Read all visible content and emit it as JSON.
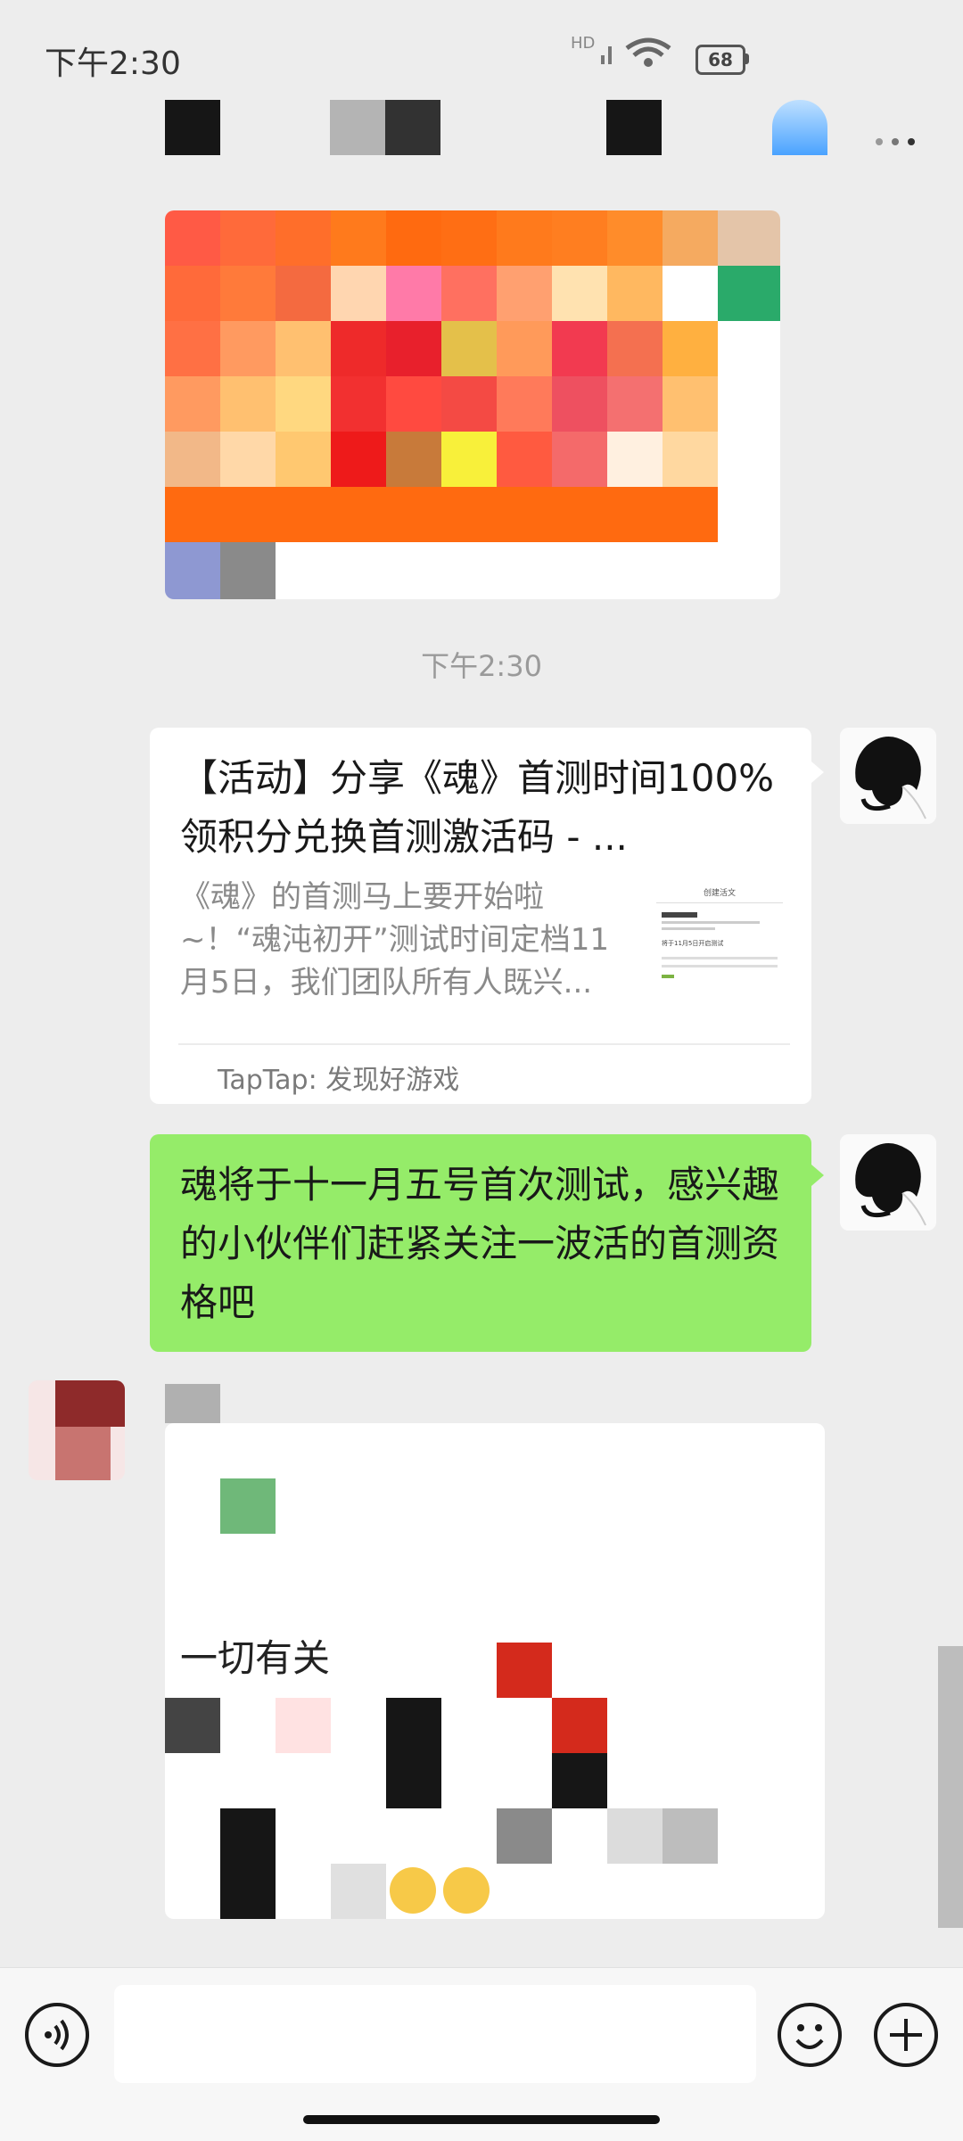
{
  "status_bar": {
    "time": "下午2:30",
    "network": "HD",
    "battery": "68"
  },
  "chat": {
    "time_divider": "下午2:30",
    "link_card": {
      "title": "【活动】分享《魂》首测时间100%领积分兑换首测激活码 - ...",
      "description": "《魂》的首测马上要开始啦~！“魂沌初开”测试时间定档11月5日，我们团队所有人既兴...",
      "source": "TapTap: 发现好游戏",
      "thumb_heading": "创建活文",
      "thumb_line": "将于11月5日开启测试"
    },
    "green_message": "魂将于十一月五号首次测试，感兴趣的小伙伴们赶紧关注一波活的首测资格吧",
    "partial_message": "一切有关"
  },
  "input_bar": {
    "placeholder": ""
  },
  "icons": {
    "voice": "voice-icon",
    "emoji": "emoji-icon",
    "plus": "plus-icon",
    "more": "more-icon"
  }
}
